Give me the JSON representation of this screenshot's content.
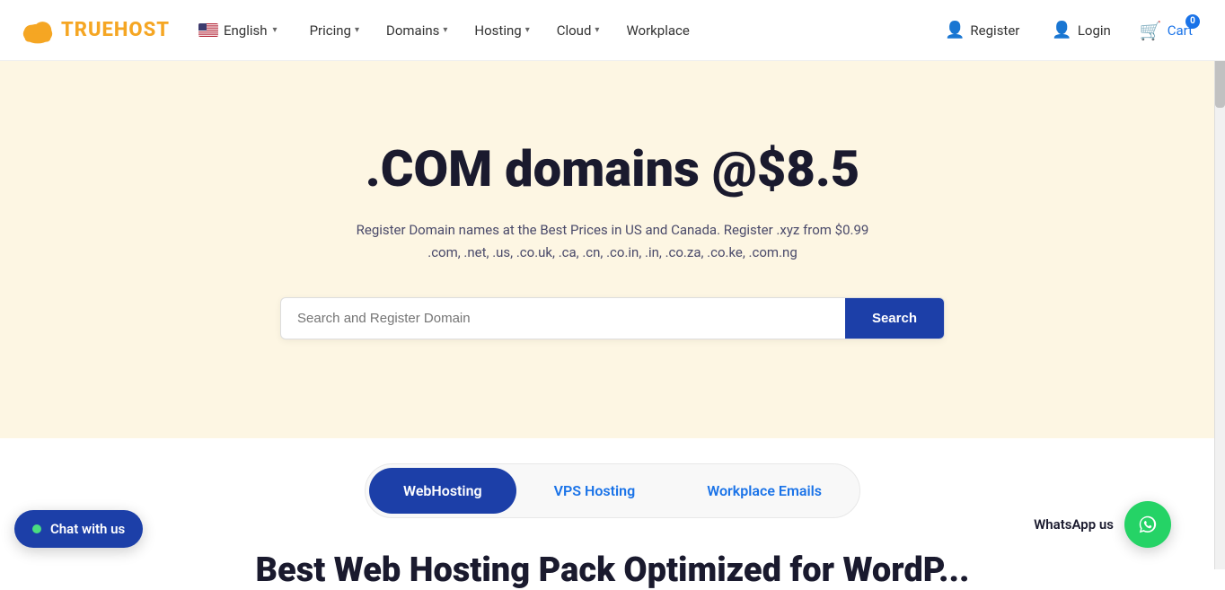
{
  "brand": {
    "name": "TRUEHOST",
    "logo_color": "#f5a623"
  },
  "nav": {
    "lang_label": "English",
    "links": [
      {
        "id": "pricing",
        "label": "Pricing",
        "has_dropdown": true
      },
      {
        "id": "domains",
        "label": "Domains",
        "has_dropdown": true
      },
      {
        "id": "hosting",
        "label": "Hosting",
        "has_dropdown": true
      },
      {
        "id": "cloud",
        "label": "Cloud",
        "has_dropdown": true
      },
      {
        "id": "workplace",
        "label": "Workplace",
        "has_dropdown": false
      }
    ],
    "register_label": "Register",
    "login_label": "Login",
    "cart_label": "Cart",
    "cart_count": "0"
  },
  "hero": {
    "title": ".COM domains @$8.5",
    "subtitle": "Register Domain names at the Best Prices in US and Canada. Register .xyz from $0.99 .com, .net, .us, .co.uk, .ca, .cn, .co.in, .in, .co.za, .co.ke, .com.ng",
    "search_placeholder": "Search and Register Domain",
    "search_button": "Search"
  },
  "tabs": [
    {
      "id": "webhosting",
      "label": "WebHosting",
      "active": true
    },
    {
      "id": "vps",
      "label": "VPS Hosting",
      "active": false
    },
    {
      "id": "workplace-emails",
      "label": "Workplace Emails",
      "active": false
    }
  ],
  "chat": {
    "label": "Chat with us"
  },
  "whatsapp": {
    "label": "WhatsApp us"
  },
  "bottom": {
    "partial_title": "Best Web Hosting Pack Optimized for WordP..."
  }
}
